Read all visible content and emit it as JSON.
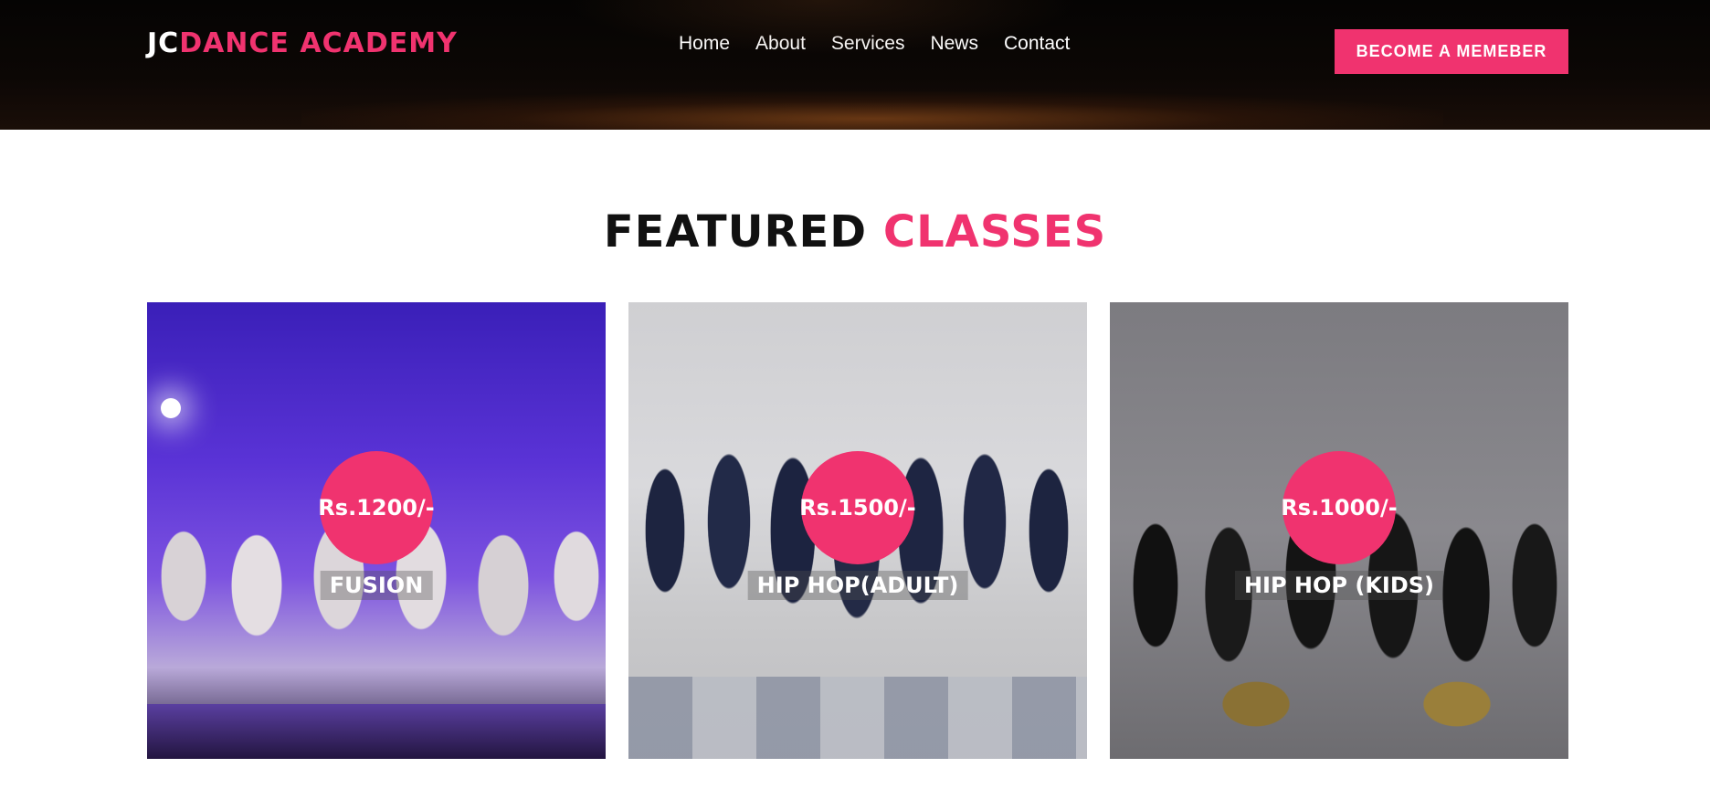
{
  "brand": {
    "prefix": "JC",
    "name": "DANCE ACADEMY"
  },
  "nav": {
    "items": [
      {
        "label": "Home"
      },
      {
        "label": "About"
      },
      {
        "label": "Services"
      },
      {
        "label": "News"
      },
      {
        "label": "Contact"
      }
    ]
  },
  "header": {
    "cta_label": "BECOME A MEMEBER"
  },
  "featured": {
    "title_part1": "FEATURED",
    "title_part2": "CLASSES",
    "classes": [
      {
        "price": "Rs.1200/-",
        "name": "FUSION"
      },
      {
        "price": "Rs.1500/-",
        "name": "HIP HOP(ADULT)"
      },
      {
        "price": "Rs.1000/-",
        "name": "HIP HOP (KIDS)"
      }
    ]
  },
  "colors": {
    "accent": "#f0336f",
    "header_bg": "#050403",
    "text_dark": "#111111"
  }
}
